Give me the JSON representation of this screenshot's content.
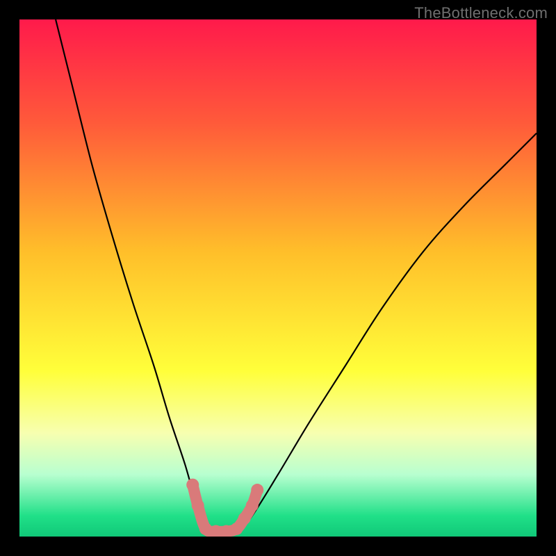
{
  "watermark": "TheBottleneck.com",
  "chart_data": {
    "type": "line",
    "title": "",
    "xlabel": "",
    "ylabel": "",
    "xlim": [
      0,
      100
    ],
    "ylim": [
      0,
      100
    ],
    "background_gradient": {
      "stops": [
        {
          "pos": 0.0,
          "color": "#ff1a4b"
        },
        {
          "pos": 0.2,
          "color": "#ff5a3a"
        },
        {
          "pos": 0.45,
          "color": "#ffbf2a"
        },
        {
          "pos": 0.68,
          "color": "#ffff3a"
        },
        {
          "pos": 0.8,
          "color": "#f7ffb0"
        },
        {
          "pos": 0.88,
          "color": "#b8ffd0"
        },
        {
          "pos": 0.96,
          "color": "#20e088"
        },
        {
          "pos": 1.0,
          "color": "#10c878"
        }
      ]
    },
    "series": [
      {
        "name": "bottleneck-curve-left",
        "color": "#000000",
        "points": [
          {
            "x": 7,
            "y": 100
          },
          {
            "x": 10,
            "y": 88
          },
          {
            "x": 14,
            "y": 72
          },
          {
            "x": 18,
            "y": 58
          },
          {
            "x": 22,
            "y": 45
          },
          {
            "x": 26,
            "y": 33
          },
          {
            "x": 29,
            "y": 23
          },
          {
            "x": 32,
            "y": 14
          },
          {
            "x": 34,
            "y": 7
          },
          {
            "x": 35.5,
            "y": 3
          },
          {
            "x": 37,
            "y": 0.5
          }
        ]
      },
      {
        "name": "bottleneck-curve-right",
        "color": "#000000",
        "points": [
          {
            "x": 42,
            "y": 0.5
          },
          {
            "x": 45,
            "y": 4
          },
          {
            "x": 50,
            "y": 12
          },
          {
            "x": 56,
            "y": 22
          },
          {
            "x": 63,
            "y": 33
          },
          {
            "x": 70,
            "y": 44
          },
          {
            "x": 78,
            "y": 55
          },
          {
            "x": 86,
            "y": 64
          },
          {
            "x": 94,
            "y": 72
          },
          {
            "x": 100,
            "y": 78
          }
        ]
      }
    ],
    "highlight": {
      "name": "optimal-zone-markers",
      "color": "#d97a7a",
      "points": [
        {
          "x": 33.5,
          "y": 10
        },
        {
          "x": 34.5,
          "y": 6
        },
        {
          "x": 36,
          "y": 1.5
        },
        {
          "x": 38,
          "y": 1
        },
        {
          "x": 40,
          "y": 1
        },
        {
          "x": 42,
          "y": 1.5
        },
        {
          "x": 43.5,
          "y": 3.5
        },
        {
          "x": 45,
          "y": 6
        },
        {
          "x": 46,
          "y": 9
        }
      ],
      "radius": 9
    }
  }
}
